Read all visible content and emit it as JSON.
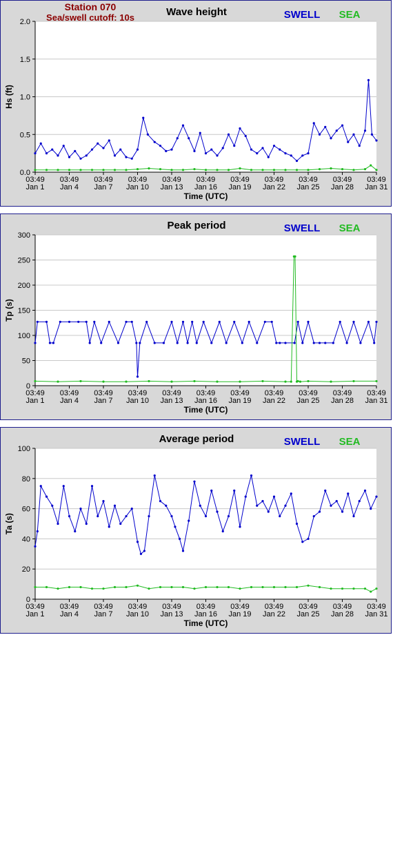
{
  "header": {
    "station": "Station 070",
    "cutoff": "Sea/swell cutoff: 10s"
  },
  "colors": {
    "swell": "#0000cc",
    "sea": "#22bb22",
    "grid": "#c8c8c8",
    "panel_bg": "#d8d8d8",
    "border": "#1c1c8c"
  },
  "chart_data": [
    {
      "type": "line",
      "title": "Wave height",
      "xlabel": "Time (UTC)",
      "ylabel": "Hs (ft)",
      "ylim": [
        0,
        2.0
      ],
      "yticks": [
        "0.0",
        "0.5",
        "1.0",
        "1.5",
        "2.0"
      ],
      "ytick_values": [
        0,
        0.5,
        1.0,
        1.5,
        2.0
      ],
      "xlim_days": [
        1,
        31
      ],
      "xtick_times": [
        "03:49",
        "03:49",
        "03:49",
        "03:49",
        "03:49",
        "03:49",
        "03:49",
        "03:49",
        "03:49",
        "03:49",
        "03:49"
      ],
      "xtick_dates": [
        "Jan 1",
        "Jan 4",
        "Jan 7",
        "Jan 10",
        "Jan 13",
        "Jan 16",
        "Jan 19",
        "Jan 22",
        "Jan 25",
        "Jan 28",
        "Jan 31"
      ],
      "xtick_days": [
        1,
        4,
        7,
        10,
        13,
        16,
        19,
        22,
        25,
        28,
        31
      ],
      "grid": true,
      "legend": [
        "SWELL",
        "SEA"
      ],
      "legend_placement": "top-right",
      "series": [
        {
          "name": "SWELL",
          "color": "#0000cc",
          "x": [
            1.0,
            1.5,
            2.0,
            2.5,
            3.0,
            3.5,
            4.0,
            4.5,
            5.0,
            5.5,
            6.0,
            6.5,
            7.0,
            7.5,
            8.0,
            8.5,
            9.0,
            9.5,
            10.0,
            10.5,
            10.9,
            11.5,
            12.0,
            12.5,
            13.0,
            13.5,
            14.0,
            14.5,
            15.0,
            15.5,
            16.0,
            16.5,
            17.0,
            17.5,
            18.0,
            18.5,
            19.0,
            19.5,
            20.0,
            20.5,
            21.0,
            21.5,
            22.0,
            22.5,
            23.0,
            23.5,
            24.0,
            24.5,
            25.0,
            25.5,
            26.0,
            26.5,
            27.0,
            27.5,
            28.0,
            28.5,
            29.0,
            29.5,
            30.0,
            30.3,
            30.6,
            31.0
          ],
          "y": [
            0.25,
            0.38,
            0.25,
            0.3,
            0.22,
            0.35,
            0.2,
            0.28,
            0.18,
            0.22,
            0.3,
            0.38,
            0.32,
            0.42,
            0.22,
            0.3,
            0.2,
            0.18,
            0.3,
            0.72,
            0.5,
            0.4,
            0.35,
            0.28,
            0.3,
            0.45,
            0.62,
            0.45,
            0.28,
            0.52,
            0.25,
            0.3,
            0.22,
            0.32,
            0.5,
            0.35,
            0.58,
            0.48,
            0.3,
            0.25,
            0.32,
            0.2,
            0.35,
            0.3,
            0.25,
            0.22,
            0.15,
            0.22,
            0.25,
            0.65,
            0.5,
            0.6,
            0.45,
            0.55,
            0.62,
            0.4,
            0.5,
            0.35,
            0.55,
            1.22,
            0.5,
            0.42
          ]
        },
        {
          "name": "SEA",
          "color": "#22bb22",
          "x": [
            1,
            2,
            3,
            4,
            5,
            6,
            7,
            8,
            9,
            10,
            11,
            12,
            13,
            14,
            15,
            16,
            17,
            18,
            19,
            20,
            21,
            22,
            23,
            24,
            25,
            26,
            27,
            28,
            29,
            30,
            30.5,
            31
          ],
          "y": [
            0.03,
            0.03,
            0.03,
            0.03,
            0.03,
            0.03,
            0.03,
            0.03,
            0.03,
            0.04,
            0.05,
            0.04,
            0.03,
            0.03,
            0.04,
            0.03,
            0.03,
            0.03,
            0.05,
            0.03,
            0.03,
            0.03,
            0.03,
            0.03,
            0.03,
            0.04,
            0.05,
            0.04,
            0.03,
            0.04,
            0.09,
            0.03
          ]
        }
      ]
    },
    {
      "type": "line",
      "title": "Peak period",
      "xlabel": "Time (UTC)",
      "ylabel": "Tp (s)",
      "ylim": [
        0,
        300
      ],
      "yticks": [
        "0",
        "50",
        "100",
        "150",
        "200",
        "250",
        "300"
      ],
      "ytick_values": [
        0,
        50,
        100,
        150,
        200,
        250,
        300
      ],
      "xlim_days": [
        1,
        31
      ],
      "xtick_times": [
        "03:49",
        "03:49",
        "03:49",
        "03:49",
        "03:49",
        "03:49",
        "03:49",
        "03:49",
        "03:49",
        "03:49",
        "03:49"
      ],
      "xtick_dates": [
        "Jan 1",
        "Jan 4",
        "Jan 7",
        "Jan 10",
        "Jan 13",
        "Jan 16",
        "Jan 19",
        "Jan 22",
        "Jan 25",
        "Jan 28",
        "Jan 31"
      ],
      "xtick_days": [
        1,
        4,
        7,
        10,
        13,
        16,
        19,
        22,
        25,
        28,
        31
      ],
      "grid": true,
      "legend": [
        "SWELL",
        "SEA"
      ],
      "legend_placement": "top-right",
      "series": [
        {
          "name": "SWELL",
          "color": "#0000cc",
          "x": [
            1.0,
            1.2,
            2.0,
            2.3,
            2.6,
            3.2,
            4.0,
            4.8,
            5.5,
            5.8,
            6.2,
            6.8,
            7.5,
            8.3,
            9.0,
            9.5,
            9.9,
            10.0,
            10.2,
            10.8,
            11.5,
            12.3,
            13.0,
            13.5,
            14.0,
            14.4,
            14.8,
            15.2,
            15.8,
            16.5,
            17.2,
            17.8,
            18.5,
            19.2,
            19.8,
            20.5,
            21.2,
            21.8,
            22.2,
            22.5,
            23.0,
            23.8,
            24.1,
            24.5,
            25.0,
            25.5,
            26.0,
            26.5,
            27.2,
            27.8,
            28.4,
            29.0,
            29.6,
            30.3,
            30.8,
            31.0
          ],
          "y": [
            85,
            127,
            127,
            85,
            85,
            127,
            127,
            127,
            127,
            85,
            127,
            85,
            127,
            85,
            127,
            127,
            85,
            18,
            85,
            127,
            85,
            85,
            127,
            85,
            127,
            85,
            127,
            85,
            127,
            85,
            127,
            85,
            127,
            85,
            127,
            85,
            127,
            127,
            85,
            85,
            85,
            85,
            127,
            85,
            127,
            85,
            85,
            85,
            85,
            127,
            85,
            127,
            85,
            127,
            85,
            127
          ]
        },
        {
          "name": "SEA",
          "color": "#22bb22",
          "x": [
            1,
            3,
            5,
            7,
            9,
            11,
            13,
            15,
            17,
            19,
            21,
            23,
            23.5,
            23.75,
            23.85,
            24.0,
            24.1,
            24.3,
            25,
            27,
            29,
            31
          ],
          "y": [
            9,
            8,
            9,
            8,
            8,
            9,
            8,
            9,
            8,
            8,
            9,
            8,
            8,
            257,
            257,
            8,
            9,
            8,
            9,
            8,
            9,
            9
          ]
        }
      ]
    },
    {
      "type": "line",
      "title": "Average period",
      "xlabel": "Time (UTC)",
      "ylabel": "Ta (s)",
      "ylim": [
        0,
        100
      ],
      "yticks": [
        "0",
        "20",
        "40",
        "60",
        "80",
        "100"
      ],
      "ytick_values": [
        0,
        20,
        40,
        60,
        80,
        100
      ],
      "xlim_days": [
        1,
        31
      ],
      "xtick_times": [
        "03:49",
        "03:49",
        "03:49",
        "03:49",
        "03:49",
        "03:49",
        "03:49",
        "03:49",
        "03:49",
        "03:49",
        "03:49"
      ],
      "xtick_dates": [
        "Jan 1",
        "Jan 4",
        "Jan 7",
        "Jan 10",
        "Jan 13",
        "Jan 16",
        "Jan 19",
        "Jan 22",
        "Jan 25",
        "Jan 28",
        "Jan 31"
      ],
      "xtick_days": [
        1,
        4,
        7,
        10,
        13,
        16,
        19,
        22,
        25,
        28,
        31
      ],
      "grid": true,
      "legend": [
        "SWELL",
        "SEA"
      ],
      "legend_placement": "top-right",
      "series": [
        {
          "name": "SWELL",
          "color": "#0000cc",
          "x": [
            1.0,
            1.2,
            1.5,
            2.0,
            2.5,
            3.0,
            3.5,
            4.0,
            4.5,
            5.0,
            5.5,
            6.0,
            6.5,
            7.0,
            7.5,
            8.0,
            8.5,
            9.0,
            9.5,
            10.0,
            10.3,
            10.6,
            11.0,
            11.5,
            12.0,
            12.5,
            13.0,
            13.3,
            13.7,
            14.0,
            14.5,
            15.0,
            15.5,
            16.0,
            16.5,
            17.0,
            17.5,
            18.0,
            18.5,
            19.0,
            19.5,
            20.0,
            20.5,
            21.0,
            21.5,
            22.0,
            22.5,
            23.0,
            23.5,
            24.0,
            24.5,
            25.0,
            25.5,
            26.0,
            26.5,
            27.0,
            27.5,
            28.0,
            28.5,
            29.0,
            29.5,
            30.0,
            30.5,
            31.0
          ],
          "y": [
            35,
            45,
            75,
            68,
            62,
            50,
            75,
            55,
            45,
            60,
            50,
            75,
            55,
            65,
            48,
            62,
            50,
            55,
            60,
            38,
            30,
            32,
            55,
            82,
            65,
            62,
            55,
            48,
            40,
            32,
            52,
            78,
            62,
            55,
            72,
            58,
            45,
            55,
            72,
            48,
            68,
            82,
            62,
            65,
            58,
            68,
            55,
            62,
            70,
            50,
            38,
            40,
            55,
            58,
            72,
            62,
            65,
            58,
            70,
            55,
            65,
            72,
            60,
            68
          ]
        },
        {
          "name": "SEA",
          "color": "#22bb22",
          "x": [
            1,
            2,
            3,
            4,
            5,
            6,
            7,
            8,
            9,
            10,
            11,
            12,
            13,
            14,
            15,
            16,
            17,
            18,
            19,
            20,
            21,
            22,
            23,
            24,
            25,
            26,
            27,
            28,
            29,
            30,
            30.5,
            31
          ],
          "y": [
            8,
            8,
            7,
            8,
            8,
            7,
            7,
            8,
            8,
            9,
            7,
            8,
            8,
            8,
            7,
            8,
            8,
            8,
            7,
            8,
            8,
            8,
            8,
            8,
            9,
            8,
            7,
            7,
            7,
            7,
            5,
            7
          ]
        }
      ]
    }
  ]
}
